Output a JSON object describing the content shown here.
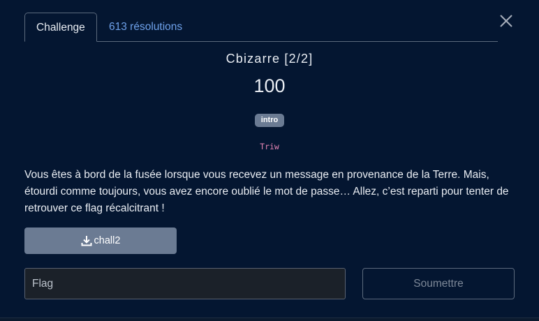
{
  "tabs": [
    {
      "label": "Challenge",
      "active": true
    },
    {
      "label": "613 résolutions",
      "active": false
    }
  ],
  "close_icon": "close-icon",
  "challenge": {
    "title": "Cbizarre [2/2]",
    "points": "100",
    "tag": "intro",
    "author": "Triw",
    "description": "Vous êtes à bord de la fusée lorsque vous recevez un message en provenance de la Terre. Mais, étourdi comme toujours, vous avez encore oublié le mot de passe… Allez, c’est reparti pour tenter de retrouver ce flag récalcitrant !"
  },
  "file": {
    "icon": "download-icon",
    "label": "chall2"
  },
  "form": {
    "flag_placeholder": "Flag",
    "flag_value": "",
    "submit_label": "Soumettre"
  },
  "colors": {
    "background": "#041631",
    "accent_link": "#6ea1ea",
    "author": "#e685b5",
    "button": "#6b7b93"
  }
}
